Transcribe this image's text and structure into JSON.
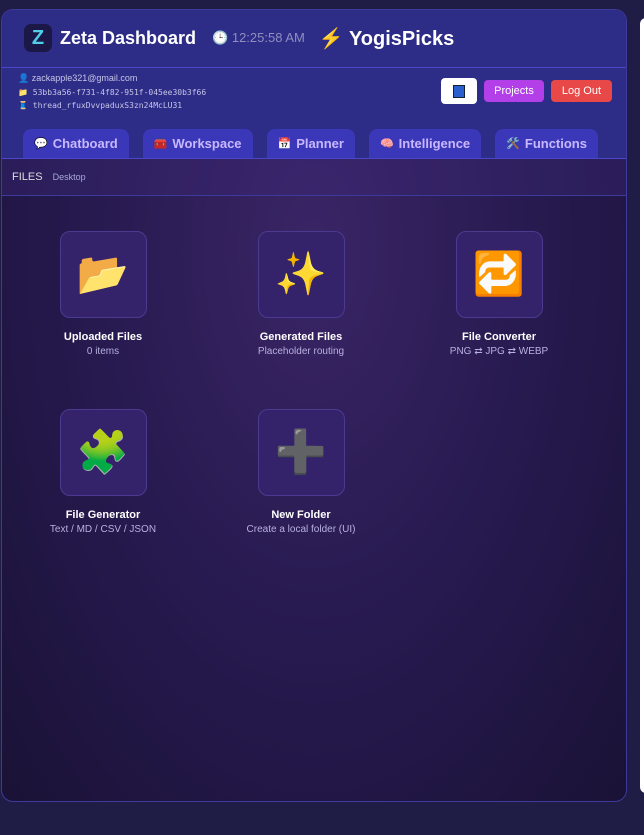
{
  "header": {
    "logo_letter": "Z",
    "title": "Zeta Dashboard",
    "time": "12:25:58 AM",
    "brand": "YogisPicks"
  },
  "meta": {
    "email": "zackapple321@gmail.com",
    "project_id": "53bb3a56-f731-4f82-951f-045ee30b3f66",
    "thread": "thread_rfuxDvvpaduxS3zn24McLU31"
  },
  "buttons": {
    "projects": "Projects",
    "logout": "Log Out"
  },
  "tabs": [
    {
      "icon": "💬",
      "label": "Chatboard"
    },
    {
      "icon": "🧰",
      "label": "Workspace"
    },
    {
      "icon": "📅",
      "label": "Planner"
    },
    {
      "icon": "🧠",
      "label": "Intelligence"
    },
    {
      "icon": "🛠️",
      "label": "Functions"
    }
  ],
  "breadcrumb": {
    "section": "FILES",
    "location": "Desktop"
  },
  "tiles": [
    {
      "icon": "📂",
      "name": "Uploaded Files",
      "sub": "0 items"
    },
    {
      "icon": "✨",
      "name": "Generated Files",
      "sub": "Placeholder routing"
    },
    {
      "icon": "🔁",
      "name": "File Converter",
      "sub": "PNG ⇄ JPG ⇄ WEBP"
    },
    {
      "icon": "🧩",
      "name": "File Generator",
      "sub": "Text / MD / CSV / JSON"
    },
    {
      "icon": "➕",
      "name": "New Folder",
      "sub": "Create a local folder (UI)"
    }
  ]
}
